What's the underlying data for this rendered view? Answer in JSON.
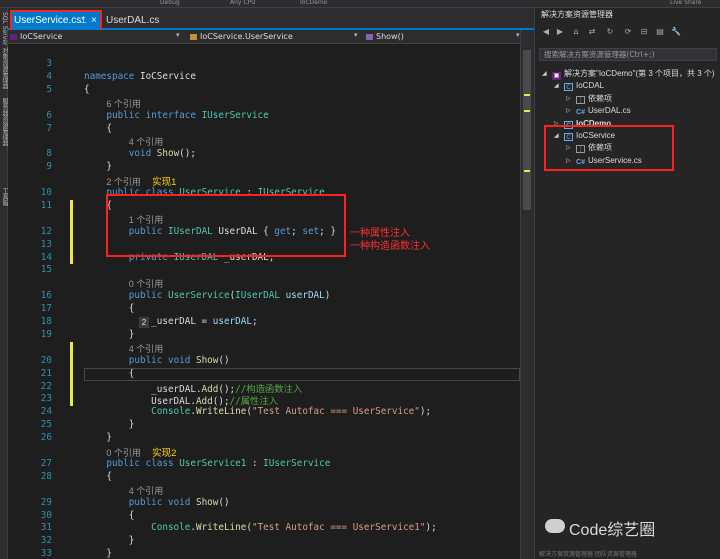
{
  "toolbar": {
    "fields": [
      "Debug",
      "Any CPU",
      "IoCDemo",
      "Live Share"
    ]
  },
  "left_strip": {
    "labels": [
      "SQL Server 对象资源管理器",
      "服务器资源管理器",
      "工具箱"
    ]
  },
  "tabs": [
    {
      "label": "UserService.cs*",
      "pin": "⊥",
      "close": "×"
    },
    {
      "label": "UserDAL.cs"
    }
  ],
  "nav": {
    "project": "IoCService",
    "class": "IoCService.UserService",
    "member": "Show()"
  },
  "code_lines": [
    {
      "ln": "3",
      "html": ""
    },
    {
      "ln": "4",
      "html": "<span class='kw'>namespace</span> IoCService"
    },
    {
      "ln": "5",
      "html": "{"
    },
    {
      "ln": "",
      "html": "    <span class='ref'>6 个引用</span>"
    },
    {
      "ln": "6",
      "html": "    <span class='kw'>public</span> <span class='kw'>interface</span> <span class='ty'>IUserService</span>"
    },
    {
      "ln": "7",
      "html": "    {"
    },
    {
      "ln": "",
      "html": "        <span class='ref'>4 个引用</span>"
    },
    {
      "ln": "8",
      "html": "        <span class='kw'>void</span> <span class='fn'>Show</span>();"
    },
    {
      "ln": "9",
      "html": "    }"
    },
    {
      "ln": "",
      "html": "    <span class='ref'>2 个引用</span>  <span class='ann'>实现1</span>"
    },
    {
      "ln": "10",
      "html": "    <span class='kw'>public</span> <span class='kw'>class</span> <span class='ty'>UserService</span> : <span class='ty'>IUserService</span>"
    },
    {
      "ln": "11",
      "html": "    {"
    },
    {
      "ln": "",
      "html": "        <span class='ref'>1 个引用</span>"
    },
    {
      "ln": "12",
      "html": "        <span class='kw'>public</span> <span class='ty'>IUserDAL</span> UserDAL { <span class='kw'>get</span>; <span class='kw'>set</span>; }"
    },
    {
      "ln": "13",
      "html": ""
    },
    {
      "ln": "14",
      "html": "        <span class='kw'>private</span> <span class='ty'>IUserDAL</span> _userDAL;"
    },
    {
      "ln": "15",
      "html": ""
    },
    {
      "ln": "",
      "html": "        <span class='ref'>0 个引用</span>"
    },
    {
      "ln": "16",
      "html": "        <span class='kw'>public</span> <span class='ty'>UserService</span>(<span class='ty'>IUserDAL</span> <span class='pm'>userDAL</span>)"
    },
    {
      "ln": "17",
      "html": "        {"
    },
    {
      "ln": "18",
      "html": "            _userDAL = <span class='pm'>userDAL</span>;"
    },
    {
      "ln": "19",
      "html": "        }"
    },
    {
      "ln": "",
      "html": "        <span class='ref'>4 个引用</span>"
    },
    {
      "ln": "20",
      "html": "        <span class='kw'>public</span> <span class='kw'>void</span> <span class='fn'>Show</span>()"
    },
    {
      "ln": "21",
      "html": "        {"
    },
    {
      "ln": "22",
      "html": "            _userDAL.<span class='fn'>Add</span>();<span class='cm'>//构造函数注入</span>"
    },
    {
      "ln": "23",
      "html": "            UserDAL.<span class='fn'>Add</span>();<span class='cm'>//属性注入</span>"
    },
    {
      "ln": "24",
      "html": "            <span class='ty'>Console</span>.<span class='fn'>WriteLine</span>(<span class='str'>\"Test Autofac === UserService\"</span>);"
    },
    {
      "ln": "25",
      "html": "        }"
    },
    {
      "ln": "26",
      "html": "    }"
    },
    {
      "ln": "",
      "html": "    <span class='ref'>0 个引用</span>  <span class='ann'>实现2</span>"
    },
    {
      "ln": "27",
      "html": "    <span class='kw'>public</span> <span class='kw'>class</span> <span class='ty'>UserService1</span> : <span class='ty'>IUserService</span>"
    },
    {
      "ln": "28",
      "html": "    {"
    },
    {
      "ln": "",
      "html": "        <span class='ref'>4 个引用</span>"
    },
    {
      "ln": "29",
      "html": "        <span class='kw'>public</span> <span class='kw'>void</span> <span class='fn'>Show</span>()"
    },
    {
      "ln": "30",
      "html": "        {"
    },
    {
      "ln": "31",
      "html": "            <span class='ty'>Console</span>.<span class='fn'>WriteLine</span>(<span class='str'>\"Test Autofac === UserService1\"</span>);"
    },
    {
      "ln": "32",
      "html": "        }"
    },
    {
      "ln": "33",
      "html": "    }"
    }
  ],
  "annotations": {
    "property_injection": "一种属性注入",
    "constructor_injection": "一种构造函数注入",
    "lightbulb": "2"
  },
  "solution_explorer": {
    "title": "解决方案资源管理器",
    "search_placeholder": "搜索解决方案资源管理器(Ctrl+;)",
    "tree": [
      {
        "label": "解决方案\"IoCDemo\"(第 3 个项目，共 3 个)",
        "icon": "solution-icon",
        "depth": 0,
        "expanded": true
      },
      {
        "label": "IoCDAL",
        "icon": "project-icon",
        "depth": 1,
        "expanded": true
      },
      {
        "label": "依赖项",
        "icon": "dependencies-icon",
        "depth": 2,
        "expanded": false
      },
      {
        "label": "UserDAL.cs",
        "icon": "csharp-file-icon",
        "depth": 2,
        "expanded": false
      },
      {
        "label": "IoCDemo",
        "icon": "project-icon",
        "depth": 1,
        "expanded": false,
        "bold": true
      },
      {
        "label": "IoCService",
        "icon": "project-icon",
        "depth": 1,
        "expanded": true
      },
      {
        "label": "依赖项",
        "icon": "dependencies-icon",
        "depth": 2,
        "expanded": false
      },
      {
        "label": "UserService.cs",
        "icon": "csharp-file-icon",
        "depth": 2,
        "expanded": false
      }
    ],
    "bottom_tabs": "解决方案资源管理器   团队资源管理器"
  },
  "watermark": "Code综艺圈",
  "colors": {
    "accent": "#007acc",
    "highlight_red": "#ff2020",
    "keyword": "#569cd6",
    "type": "#4ec9b0",
    "string": "#d69d85",
    "comment": "#57a64a",
    "line_number": "#2b91af",
    "change_marker": "#e8e84a"
  }
}
